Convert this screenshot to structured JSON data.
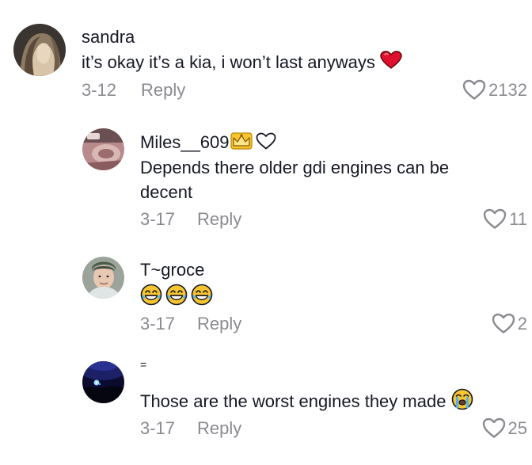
{
  "comments": [
    {
      "username": "sandra",
      "text": "it’s okay it’s a kia, i won’t last anyways",
      "text_emoji": "red-heart",
      "date": "3-12",
      "reply_label": "Reply",
      "likes": "2132"
    },
    {
      "username": "Miles__609",
      "badge": "crown",
      "text": "Depends there older gdi engines can be decent",
      "date": "3-17",
      "reply_label": "Reply",
      "likes": "11"
    },
    {
      "username": "T~groce",
      "text": "😂😂😂",
      "date": "3-17",
      "reply_label": "Reply",
      "likes": "2"
    },
    {
      "username": "=",
      "text": "Those are the worst engines they made",
      "text_emoji": "loudly-crying-face",
      "date": "3-17",
      "reply_label": "Reply",
      "likes": "25"
    }
  ],
  "colors": {
    "text": "#161823",
    "muted": "#8a8b91",
    "heart_red": "#e0102f",
    "emoji_yellow": "#f7c531"
  }
}
